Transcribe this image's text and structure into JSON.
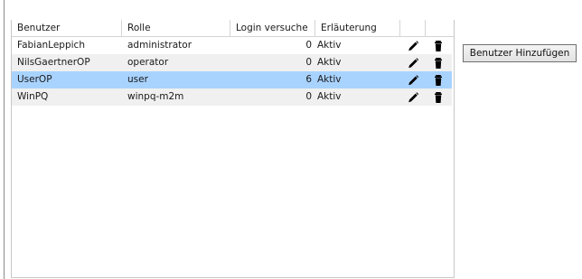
{
  "table": {
    "columns": [
      "Benutzer",
      "Rolle",
      "Login versuche",
      "Erläuterung",
      "",
      ""
    ],
    "rows": [
      {
        "user": "FabianLeppich",
        "role": "administrator",
        "attempts": "0",
        "status": "Aktiv",
        "selected": false
      },
      {
        "user": "NilsGaertnerOP",
        "role": "operator",
        "attempts": "0",
        "status": "Aktiv",
        "selected": false
      },
      {
        "user": "UserOP",
        "role": "user",
        "attempts": "6",
        "status": "Aktiv",
        "selected": true
      },
      {
        "user": "WinPQ",
        "role": "winpq-m2m",
        "attempts": "0",
        "status": "Aktiv",
        "selected": false
      }
    ],
    "row_icons": [
      "edit-pencil-icon",
      "delete-trash-icon"
    ]
  },
  "actions": {
    "add_user_label": "Benutzer Hinzufügen"
  },
  "colors": {
    "selected_row": "#a9d3ff",
    "alt_row": "#f0f0f0",
    "icon": "#000000"
  }
}
